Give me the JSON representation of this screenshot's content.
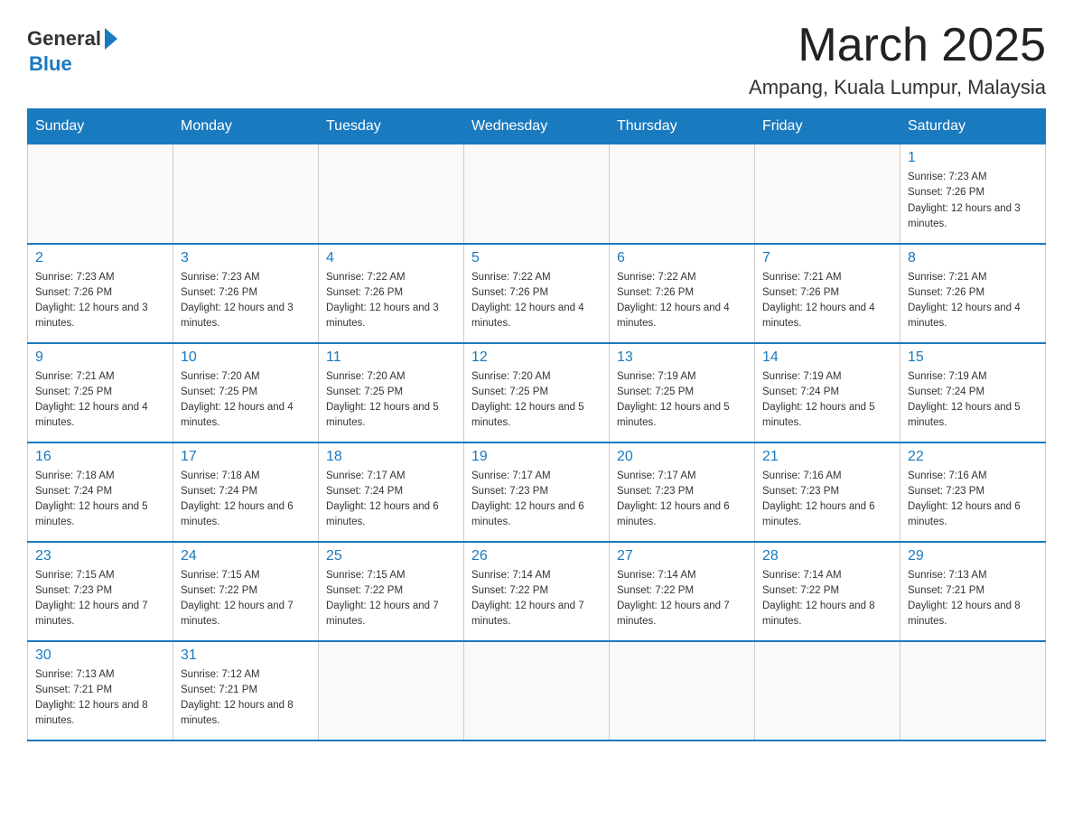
{
  "header": {
    "logo_general": "General",
    "logo_blue": "Blue",
    "month_title": "March 2025",
    "location": "Ampang, Kuala Lumpur, Malaysia"
  },
  "weekdays": [
    "Sunday",
    "Monday",
    "Tuesday",
    "Wednesday",
    "Thursday",
    "Friday",
    "Saturday"
  ],
  "weeks": [
    [
      {
        "day": "",
        "sunrise": "",
        "sunset": "",
        "daylight": ""
      },
      {
        "day": "",
        "sunrise": "",
        "sunset": "",
        "daylight": ""
      },
      {
        "day": "",
        "sunrise": "",
        "sunset": "",
        "daylight": ""
      },
      {
        "day": "",
        "sunrise": "",
        "sunset": "",
        "daylight": ""
      },
      {
        "day": "",
        "sunrise": "",
        "sunset": "",
        "daylight": ""
      },
      {
        "day": "",
        "sunrise": "",
        "sunset": "",
        "daylight": ""
      },
      {
        "day": "1",
        "sunrise": "Sunrise: 7:23 AM",
        "sunset": "Sunset: 7:26 PM",
        "daylight": "Daylight: 12 hours and 3 minutes."
      }
    ],
    [
      {
        "day": "2",
        "sunrise": "Sunrise: 7:23 AM",
        "sunset": "Sunset: 7:26 PM",
        "daylight": "Daylight: 12 hours and 3 minutes."
      },
      {
        "day": "3",
        "sunrise": "Sunrise: 7:23 AM",
        "sunset": "Sunset: 7:26 PM",
        "daylight": "Daylight: 12 hours and 3 minutes."
      },
      {
        "day": "4",
        "sunrise": "Sunrise: 7:22 AM",
        "sunset": "Sunset: 7:26 PM",
        "daylight": "Daylight: 12 hours and 3 minutes."
      },
      {
        "day": "5",
        "sunrise": "Sunrise: 7:22 AM",
        "sunset": "Sunset: 7:26 PM",
        "daylight": "Daylight: 12 hours and 4 minutes."
      },
      {
        "day": "6",
        "sunrise": "Sunrise: 7:22 AM",
        "sunset": "Sunset: 7:26 PM",
        "daylight": "Daylight: 12 hours and 4 minutes."
      },
      {
        "day": "7",
        "sunrise": "Sunrise: 7:21 AM",
        "sunset": "Sunset: 7:26 PM",
        "daylight": "Daylight: 12 hours and 4 minutes."
      },
      {
        "day": "8",
        "sunrise": "Sunrise: 7:21 AM",
        "sunset": "Sunset: 7:26 PM",
        "daylight": "Daylight: 12 hours and 4 minutes."
      }
    ],
    [
      {
        "day": "9",
        "sunrise": "Sunrise: 7:21 AM",
        "sunset": "Sunset: 7:25 PM",
        "daylight": "Daylight: 12 hours and 4 minutes."
      },
      {
        "day": "10",
        "sunrise": "Sunrise: 7:20 AM",
        "sunset": "Sunset: 7:25 PM",
        "daylight": "Daylight: 12 hours and 4 minutes."
      },
      {
        "day": "11",
        "sunrise": "Sunrise: 7:20 AM",
        "sunset": "Sunset: 7:25 PM",
        "daylight": "Daylight: 12 hours and 5 minutes."
      },
      {
        "day": "12",
        "sunrise": "Sunrise: 7:20 AM",
        "sunset": "Sunset: 7:25 PM",
        "daylight": "Daylight: 12 hours and 5 minutes."
      },
      {
        "day": "13",
        "sunrise": "Sunrise: 7:19 AM",
        "sunset": "Sunset: 7:25 PM",
        "daylight": "Daylight: 12 hours and 5 minutes."
      },
      {
        "day": "14",
        "sunrise": "Sunrise: 7:19 AM",
        "sunset": "Sunset: 7:24 PM",
        "daylight": "Daylight: 12 hours and 5 minutes."
      },
      {
        "day": "15",
        "sunrise": "Sunrise: 7:19 AM",
        "sunset": "Sunset: 7:24 PM",
        "daylight": "Daylight: 12 hours and 5 minutes."
      }
    ],
    [
      {
        "day": "16",
        "sunrise": "Sunrise: 7:18 AM",
        "sunset": "Sunset: 7:24 PM",
        "daylight": "Daylight: 12 hours and 5 minutes."
      },
      {
        "day": "17",
        "sunrise": "Sunrise: 7:18 AM",
        "sunset": "Sunset: 7:24 PM",
        "daylight": "Daylight: 12 hours and 6 minutes."
      },
      {
        "day": "18",
        "sunrise": "Sunrise: 7:17 AM",
        "sunset": "Sunset: 7:24 PM",
        "daylight": "Daylight: 12 hours and 6 minutes."
      },
      {
        "day": "19",
        "sunrise": "Sunrise: 7:17 AM",
        "sunset": "Sunset: 7:23 PM",
        "daylight": "Daylight: 12 hours and 6 minutes."
      },
      {
        "day": "20",
        "sunrise": "Sunrise: 7:17 AM",
        "sunset": "Sunset: 7:23 PM",
        "daylight": "Daylight: 12 hours and 6 minutes."
      },
      {
        "day": "21",
        "sunrise": "Sunrise: 7:16 AM",
        "sunset": "Sunset: 7:23 PM",
        "daylight": "Daylight: 12 hours and 6 minutes."
      },
      {
        "day": "22",
        "sunrise": "Sunrise: 7:16 AM",
        "sunset": "Sunset: 7:23 PM",
        "daylight": "Daylight: 12 hours and 6 minutes."
      }
    ],
    [
      {
        "day": "23",
        "sunrise": "Sunrise: 7:15 AM",
        "sunset": "Sunset: 7:23 PM",
        "daylight": "Daylight: 12 hours and 7 minutes."
      },
      {
        "day": "24",
        "sunrise": "Sunrise: 7:15 AM",
        "sunset": "Sunset: 7:22 PM",
        "daylight": "Daylight: 12 hours and 7 minutes."
      },
      {
        "day": "25",
        "sunrise": "Sunrise: 7:15 AM",
        "sunset": "Sunset: 7:22 PM",
        "daylight": "Daylight: 12 hours and 7 minutes."
      },
      {
        "day": "26",
        "sunrise": "Sunrise: 7:14 AM",
        "sunset": "Sunset: 7:22 PM",
        "daylight": "Daylight: 12 hours and 7 minutes."
      },
      {
        "day": "27",
        "sunrise": "Sunrise: 7:14 AM",
        "sunset": "Sunset: 7:22 PM",
        "daylight": "Daylight: 12 hours and 7 minutes."
      },
      {
        "day": "28",
        "sunrise": "Sunrise: 7:14 AM",
        "sunset": "Sunset: 7:22 PM",
        "daylight": "Daylight: 12 hours and 8 minutes."
      },
      {
        "day": "29",
        "sunrise": "Sunrise: 7:13 AM",
        "sunset": "Sunset: 7:21 PM",
        "daylight": "Daylight: 12 hours and 8 minutes."
      }
    ],
    [
      {
        "day": "30",
        "sunrise": "Sunrise: 7:13 AM",
        "sunset": "Sunset: 7:21 PM",
        "daylight": "Daylight: 12 hours and 8 minutes."
      },
      {
        "day": "31",
        "sunrise": "Sunrise: 7:12 AM",
        "sunset": "Sunset: 7:21 PM",
        "daylight": "Daylight: 12 hours and 8 minutes."
      },
      {
        "day": "",
        "sunrise": "",
        "sunset": "",
        "daylight": ""
      },
      {
        "day": "",
        "sunrise": "",
        "sunset": "",
        "daylight": ""
      },
      {
        "day": "",
        "sunrise": "",
        "sunset": "",
        "daylight": ""
      },
      {
        "day": "",
        "sunrise": "",
        "sunset": "",
        "daylight": ""
      },
      {
        "day": "",
        "sunrise": "",
        "sunset": "",
        "daylight": ""
      }
    ]
  ]
}
